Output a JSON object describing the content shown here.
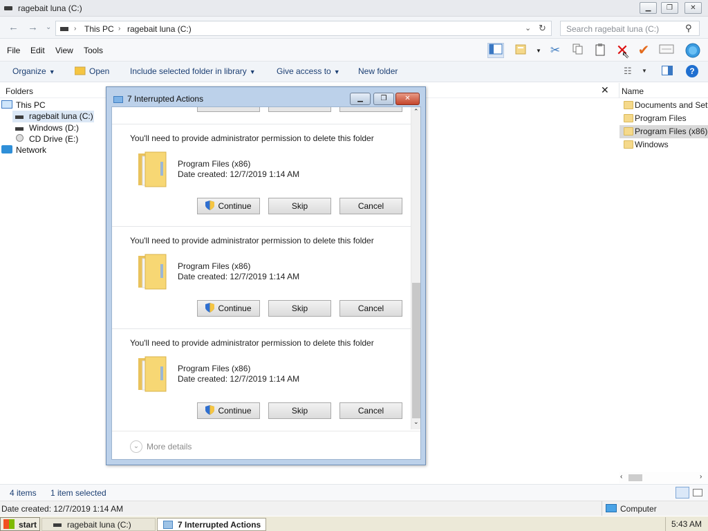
{
  "window": {
    "title": "ragebait luna (C:)"
  },
  "address": {
    "crumbs": [
      "This PC",
      "ragebait luna (C:)"
    ],
    "search_placeholder": "Search ragebait luna (C:)"
  },
  "menu": [
    "File",
    "Edit",
    "View",
    "Tools"
  ],
  "commands": {
    "organize": "Organize",
    "open": "Open",
    "include": "Include selected folder in library",
    "share": "Give access to",
    "new_folder": "New folder"
  },
  "folders_pane": {
    "header": "Folders",
    "tree": [
      {
        "label": "This PC",
        "icon": "pc-icon"
      },
      {
        "label": "ragebait luna (C:)",
        "icon": "drive-icon",
        "selected": true
      },
      {
        "label": "Windows (D:)",
        "icon": "drive-icon"
      },
      {
        "label": "CD Drive (E:)",
        "icon": "cd-icon"
      },
      {
        "label": "Network",
        "icon": "network-icon"
      }
    ]
  },
  "files": {
    "header": "Name",
    "items": [
      "Documents and Settings",
      "Program Files",
      "Program Files (x86)",
      "Windows"
    ],
    "selected_index": 2
  },
  "dialog": {
    "title": "7 Interrupted Actions",
    "sections": [
      {
        "message": "You'll need to provide administrator permission to delete this folder",
        "name": "Program Files (x86)",
        "date": "Date created: 12/7/2019 1:14 AM"
      },
      {
        "message": "You'll need to provide administrator permission to delete this folder",
        "name": "Program Files (x86)",
        "date": "Date created: 12/7/2019 1:14 AM"
      },
      {
        "message": "You'll need to provide administrator permission to delete this folder",
        "name": "Program Files (x86)",
        "date": "Date created: 12/7/2019 1:14 AM"
      }
    ],
    "buttons": {
      "continue": "Continue",
      "skip": "Skip",
      "cancel": "Cancel"
    },
    "more_details": "More details"
  },
  "status": {
    "items": "4 items",
    "selected": "1 item selected"
  },
  "details": {
    "date": "Date created: 12/7/2019 1:14 AM",
    "location": "Computer"
  },
  "taskbar": {
    "start": "start",
    "tasks": [
      "ragebait luna (C:)",
      "7 Interrupted Actions"
    ],
    "clock": "5:43 AM"
  }
}
